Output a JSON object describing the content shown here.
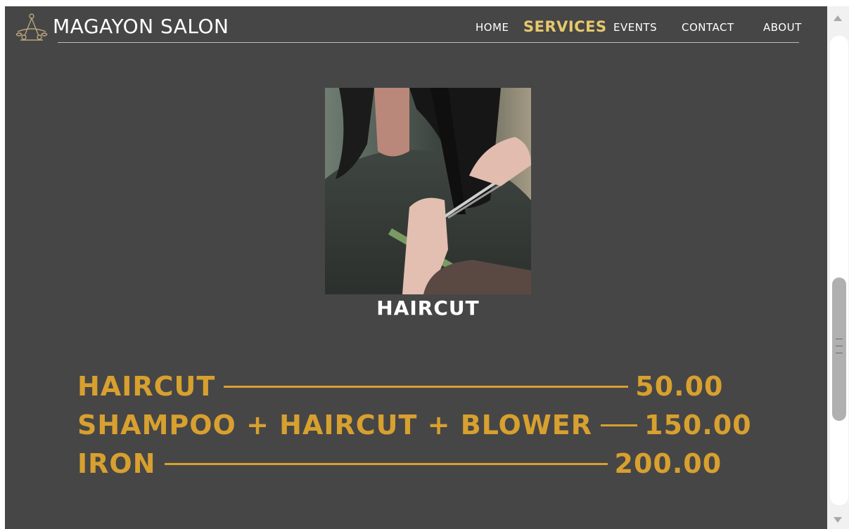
{
  "header": {
    "brand": "MAGAYON SALON",
    "logo_icon": "scissors-crest-icon"
  },
  "nav": {
    "items": [
      {
        "label": "HOME"
      },
      {
        "label": "SERVICES",
        "active": true
      },
      {
        "label": "EVENTS"
      },
      {
        "label": "CONTACT"
      },
      {
        "label": "ABOUT"
      }
    ]
  },
  "feature": {
    "image": "haircut-photo",
    "caption": "HAIRCUT"
  },
  "prices": [
    {
      "name": "HAIRCUT",
      "price": "50.00"
    },
    {
      "name": "SHAMPOO + HAIRCUT + BLOWER",
      "price": "150.00"
    },
    {
      "name": "IRON",
      "price": "200.00"
    }
  ],
  "colors": {
    "background": "#474646",
    "accent_nav": "#e7c96d",
    "price_gold": "#d7a02f",
    "text": "#ffffff"
  }
}
